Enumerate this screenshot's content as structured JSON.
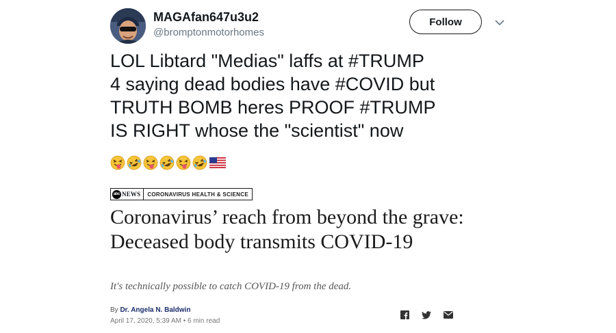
{
  "tweet": {
    "display_name": "MAGAfan647u3u2",
    "handle": "@bromptonmotorhomes",
    "follow_label": "Follow",
    "text": "LOL Libtard \"Medias\" laffs at #TRUMP\n4 saying dead bodies have #COVID but\nTRUTH BOMB heres PROOF #TRUMP\nIS RIGHT whose the \"scientist\" now",
    "emojis": [
      "face-with-tongue-emoji",
      "rolling-on-floor-laughing-emoji",
      "face-with-tongue-emoji",
      "rolling-on-floor-laughing-emoji",
      "face-with-tongue-emoji",
      "rolling-on-floor-laughing-emoji",
      "us-flag-emoji"
    ]
  },
  "article": {
    "outlet_logo_text": "abc",
    "outlet_news_word": "NEWS",
    "section": "CORONAVIRUS HEALTH & SCIENCE",
    "headline": "Coronavirus’ reach from beyond the grave: Deceased body transmits COVID-19",
    "subheadline": "It's technically possible to catch COVID-19 from the dead.",
    "by_prefix": "By",
    "author": "Dr. Angela N. Baldwin",
    "dateline": "April 17, 2020, 5:39 AM • 6 min read",
    "share_icons": [
      "facebook-icon",
      "twitter-icon",
      "email-icon"
    ]
  },
  "colors": {
    "text_primary": "#14171a",
    "text_secondary": "#657786",
    "author_link": "#1a2b6b"
  }
}
